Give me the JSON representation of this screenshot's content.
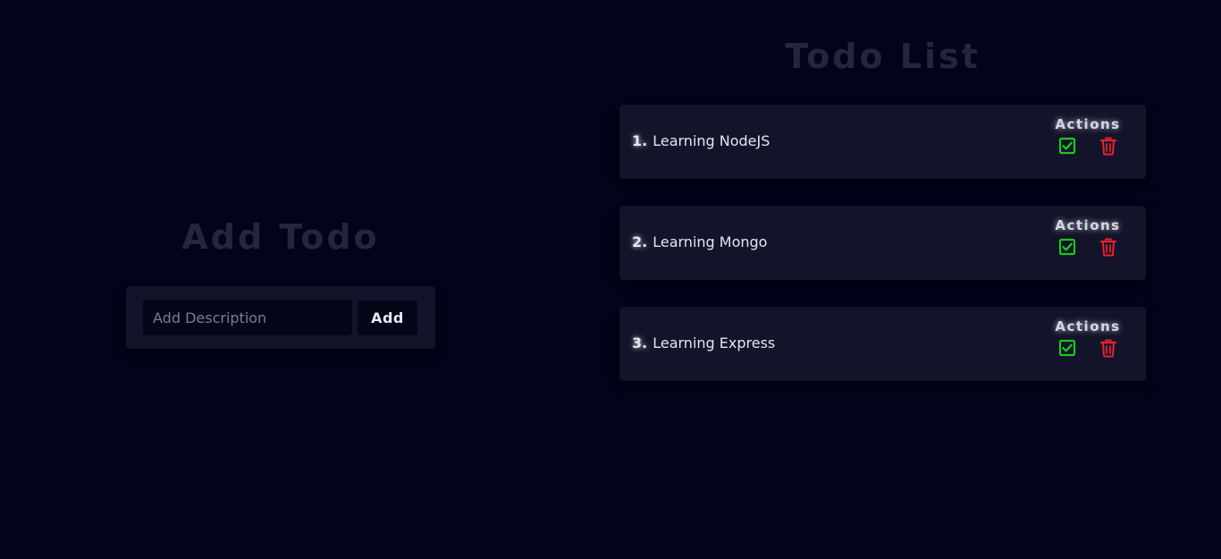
{
  "add_section": {
    "title": "Add Todo",
    "input_placeholder": "Add Description",
    "input_value": "",
    "add_label": "Add"
  },
  "list_section": {
    "title": "Todo List",
    "todos": [
      {
        "number": "1.",
        "text": "Learning NodeJS",
        "actions_label": "Actions"
      },
      {
        "number": "2.",
        "text": "Learning Mongo",
        "actions_label": "Actions"
      },
      {
        "number": "3.",
        "text": "Learning Express",
        "actions_label": "Actions"
      }
    ]
  },
  "colors": {
    "background": "#03031a",
    "card": "#13132a",
    "complete_icon": "#1ec51e",
    "delete_icon": "#e8232c"
  },
  "icons": {
    "complete": "check-square-icon",
    "delete": "trash-icon"
  }
}
